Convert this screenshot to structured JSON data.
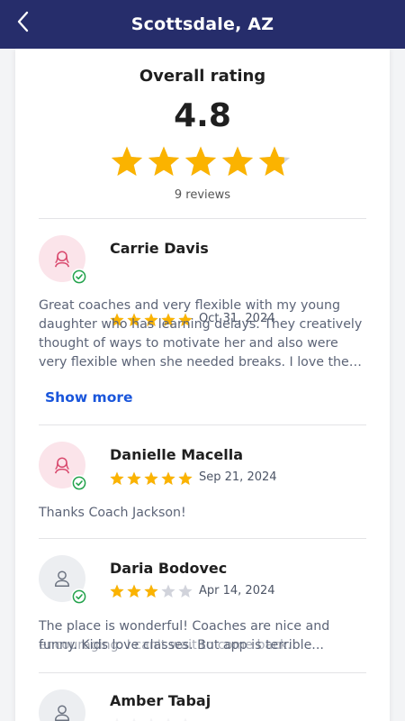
{
  "header": {
    "title": "Scottsdale, AZ",
    "back_icon": "chevron-left-icon"
  },
  "summary": {
    "title": "Overall rating",
    "value": "4.8",
    "rating": 4.8,
    "reviews_label": "9 reviews"
  },
  "colors": {
    "header_bg": "#262d6b",
    "star_filled": "#fbb300",
    "star_empty": "#d1d3db",
    "verified": "#22a24b",
    "link": "#1a56db"
  },
  "reviews": [
    {
      "name": "Carrie Davis",
      "date": "Oct 31, 2024",
      "rating": 5,
      "avatar": "female-user-icon",
      "verified": true,
      "text": "Great coaches and very flexible with my young daughter who has learning delays. They creatively thought of ways to motivate her and also were very flexible when she needed breaks. I love the exercis...",
      "show_more": "Show more"
    },
    {
      "name": "Danielle Macella",
      "date": "Sep 21, 2024",
      "rating": 5,
      "avatar": "female-user-icon",
      "verified": true,
      "text": "Thanks Coach Jackson!"
    },
    {
      "name": "Daria Bodovec",
      "date": "Apr 14, 2024",
      "rating": 3,
      "avatar": "user-icon",
      "verified": true,
      "text": "The place is wonderful! Coaches are nice and funny. Kids love classes. But app is terrible...",
      "ghost_text": "encouraging. I can't wait to come back."
    },
    {
      "name": "Amber Tabaj",
      "avatar": "user-icon"
    }
  ]
}
